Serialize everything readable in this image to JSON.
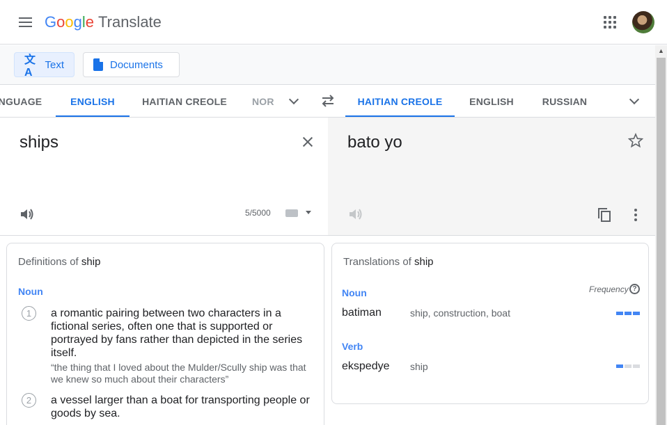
{
  "header": {
    "logo_letters": [
      "G",
      "o",
      "o",
      "g",
      "l",
      "e"
    ],
    "product": "Translate",
    "icons": {
      "menu": "hamburger-menu-icon",
      "apps": "apps-grid-icon",
      "avatar": "user-avatar"
    }
  },
  "modes": {
    "text_label": "Text",
    "documents_label": "Documents"
  },
  "source_languages": {
    "tabs": [
      "NGUAGE",
      "ENGLISH",
      "HAITIAN CREOLE",
      "NOR"
    ],
    "active": "ENGLISH"
  },
  "target_languages": {
    "tabs": [
      "HAITIAN CREOLE",
      "ENGLISH",
      "RUSSIAN"
    ],
    "active": "HAITIAN CREOLE"
  },
  "source": {
    "text": "ships",
    "char_count": "5/5000"
  },
  "target": {
    "text": "bato yo"
  },
  "definitions": {
    "title_prefix": "Definitions of",
    "word": "ship",
    "part_of_speech": "Noun",
    "items": [
      {
        "num": "1",
        "text": "a romantic pairing between two characters in a fictional series, often one that is supported or portrayed by fans rather than depicted in the series itself.",
        "example": "“the thing that I loved about the Mulder/Scully ship was that we knew so much about their characters”"
      },
      {
        "num": "2",
        "text": "a vessel larger than a boat for transporting people or goods by sea."
      }
    ]
  },
  "translations": {
    "title_prefix": "Translations of",
    "word": "ship",
    "frequency_label": "Frequency",
    "groups": [
      {
        "pos": "Noun",
        "word": "batiman",
        "synonyms": "ship, construction, boat",
        "frequency": 3
      },
      {
        "pos": "Verb",
        "word": "ekspedye",
        "synonyms": "ship",
        "frequency": 1
      }
    ]
  },
  "colors": {
    "accent": "#1a73e8",
    "google_blue": "#4285f4",
    "google_red": "#ea4335",
    "google_yellow": "#fbbc05",
    "google_green": "#34a853"
  }
}
